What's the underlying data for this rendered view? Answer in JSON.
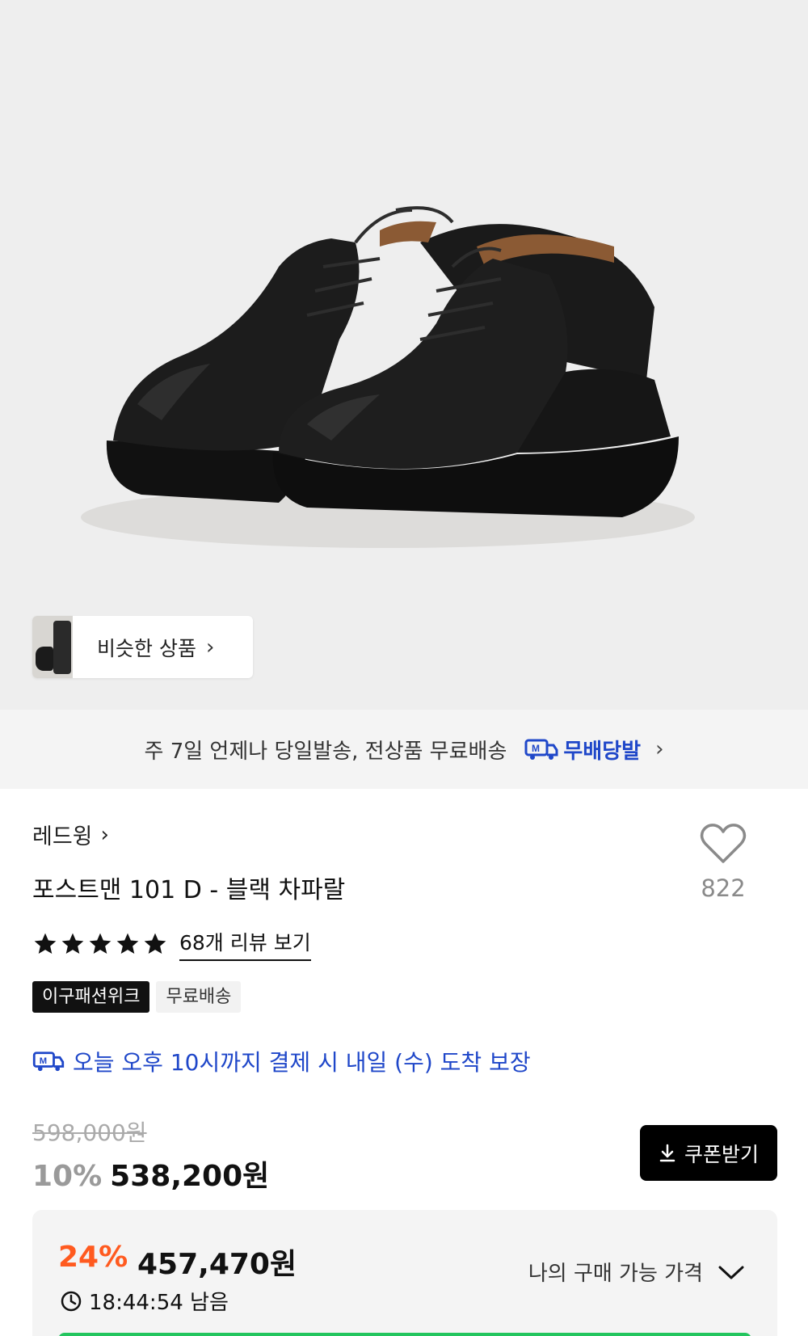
{
  "hero": {
    "image_alt": "product photo",
    "similar_label": "비슷한 상품"
  },
  "shipping_banner": {
    "text": "주 7일 언제나 당일발송, 전상품 무료배송",
    "brand_label": "무배당발",
    "badge_letter": "M"
  },
  "product": {
    "brand": "레드윙",
    "title": "포스트맨 101 D - 블랙 차파랄",
    "like_count": "822",
    "rating_stars": 5,
    "review_link": "68개 리뷰 보기",
    "tags": [
      "이구패션위크",
      "무료배송"
    ],
    "delivery_text": "오늘 오후 10시까지 결제 시 내일 (수) 도착 보장"
  },
  "price": {
    "original": "598,000원",
    "discount_rate": "10%",
    "sale_price": "538,200원",
    "coupon_label": "쿠폰받기"
  },
  "member_price": {
    "rate": "24%",
    "price": "457,470원",
    "timer": "18:44:54 남음",
    "toggle_label": "나의 구매 가능 가격"
  },
  "colors": {
    "accent_blue": "#1f47c9",
    "discount_orange": "#ff5a1f",
    "green": "#23c55e"
  }
}
